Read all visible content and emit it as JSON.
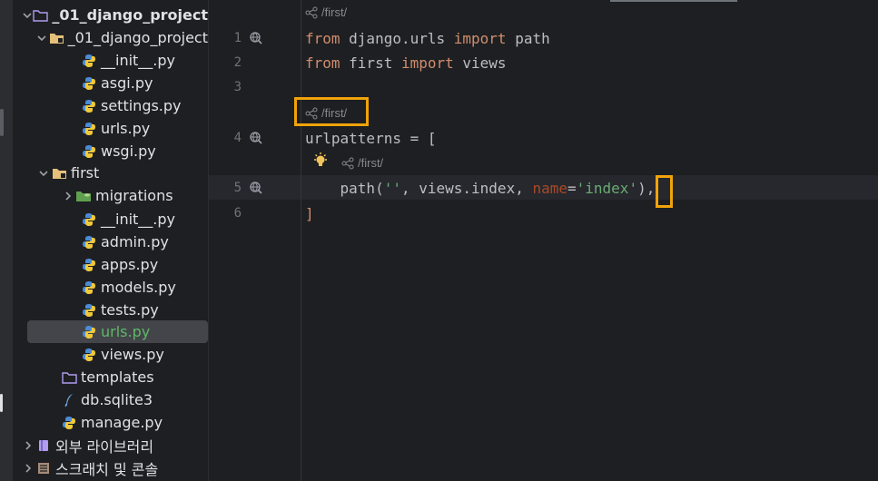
{
  "tree": {
    "root": {
      "label": "_01_django_project"
    },
    "items": [
      {
        "label": "_01_django_project"
      },
      {
        "label": "__init__.py"
      },
      {
        "label": "asgi.py"
      },
      {
        "label": "settings.py"
      },
      {
        "label": "urls.py"
      },
      {
        "label": "wsgi.py"
      },
      {
        "label": "first"
      },
      {
        "label": "migrations"
      },
      {
        "label": "__init__.py"
      },
      {
        "label": "admin.py"
      },
      {
        "label": "apps.py"
      },
      {
        "label": "models.py"
      },
      {
        "label": "tests.py"
      },
      {
        "label": "urls.py"
      },
      {
        "label": "views.py"
      },
      {
        "label": "templates"
      },
      {
        "label": "db.sqlite3"
      },
      {
        "label": "manage.py"
      },
      {
        "label": "외부 라이브러리"
      },
      {
        "label": "스크래치 및 콘솔"
      }
    ]
  },
  "editor": {
    "line_numbers": [
      "1",
      "2",
      "3",
      "4",
      "5",
      "6"
    ],
    "hints": {
      "top": "/first/",
      "mid": "/first/",
      "bulb": "/first/"
    },
    "lines": {
      "l1": {
        "kw1": "from",
        "mod": " django.urls ",
        "kw2": "import",
        "rest": " path"
      },
      "l2": {
        "kw1": "from",
        "mod": " first ",
        "kw2": "import",
        "rest": " views"
      },
      "l4": {
        "text": "urlpatterns = ["
      },
      "l5": {
        "indent": "    ",
        "fn": "path(",
        "s1": "''",
        "mid": ", views.index, ",
        "kw": "name",
        "eq": "=",
        "s2": "'index'",
        "close": ")",
        "comma": ","
      },
      "l6": {
        "text": "]"
      }
    }
  },
  "colors": {
    "keyword": "#cf8e6d",
    "string": "#6aab73",
    "named_param": "#aa4926",
    "highlight_box": "#f0a30a",
    "selected_file": "#5fb865"
  }
}
